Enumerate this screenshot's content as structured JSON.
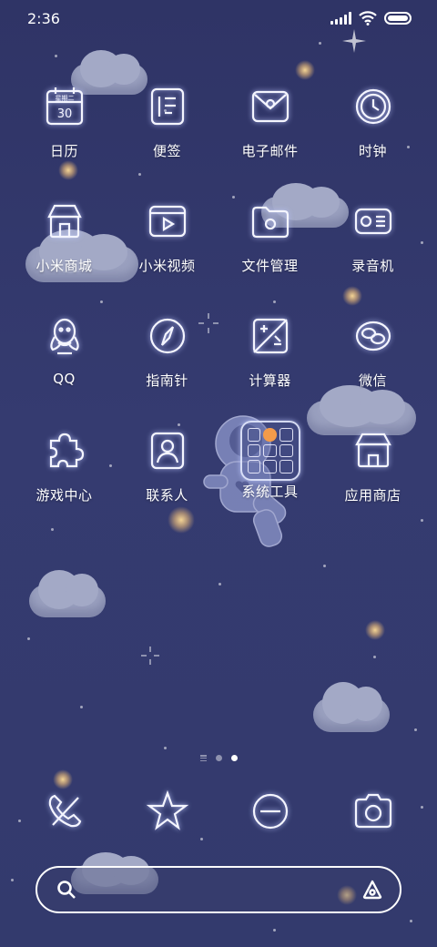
{
  "status_bar": {
    "time": "2:36",
    "icons": [
      "signal-icon",
      "wifi-icon",
      "battery-icon"
    ]
  },
  "apps": [
    {
      "label": "日历",
      "icon": "calendar-icon",
      "calendar_text": "星期二",
      "calendar_day": "30"
    },
    {
      "label": "便签",
      "icon": "notes-icon"
    },
    {
      "label": "电子邮件",
      "icon": "mail-icon"
    },
    {
      "label": "时钟",
      "icon": "clock-icon"
    },
    {
      "label": "小米商城",
      "icon": "store-icon"
    },
    {
      "label": "小米视频",
      "icon": "video-icon"
    },
    {
      "label": "文件管理",
      "icon": "folder-icon"
    },
    {
      "label": "录音机",
      "icon": "recorder-icon"
    },
    {
      "label": "QQ",
      "icon": "qq-icon"
    },
    {
      "label": "指南针",
      "icon": "compass-icon"
    },
    {
      "label": "计算器",
      "icon": "calculator-icon"
    },
    {
      "label": "微信",
      "icon": "wechat-icon"
    },
    {
      "label": "游戏中心",
      "icon": "puzzle-icon"
    },
    {
      "label": "联系人",
      "icon": "contacts-icon"
    },
    {
      "label": "系统工具",
      "icon": "folder-tools-icon"
    },
    {
      "label": "应用商店",
      "icon": "app-store-icon"
    }
  ],
  "page_indicator": {
    "pages": 3,
    "active": 2
  },
  "dock": [
    {
      "icon": "phone-icon"
    },
    {
      "icon": "messages-icon"
    },
    {
      "icon": "browser-icon"
    },
    {
      "icon": "camera-icon"
    }
  ],
  "search": {
    "value": "",
    "left_icon": "search-icon",
    "right_icon": "assistant-icon"
  },
  "colors": {
    "background": "#343a6e",
    "icon_stroke": "#f4f5ff",
    "glow": "#ffd28f",
    "folder_accent": "#f39b4a"
  }
}
